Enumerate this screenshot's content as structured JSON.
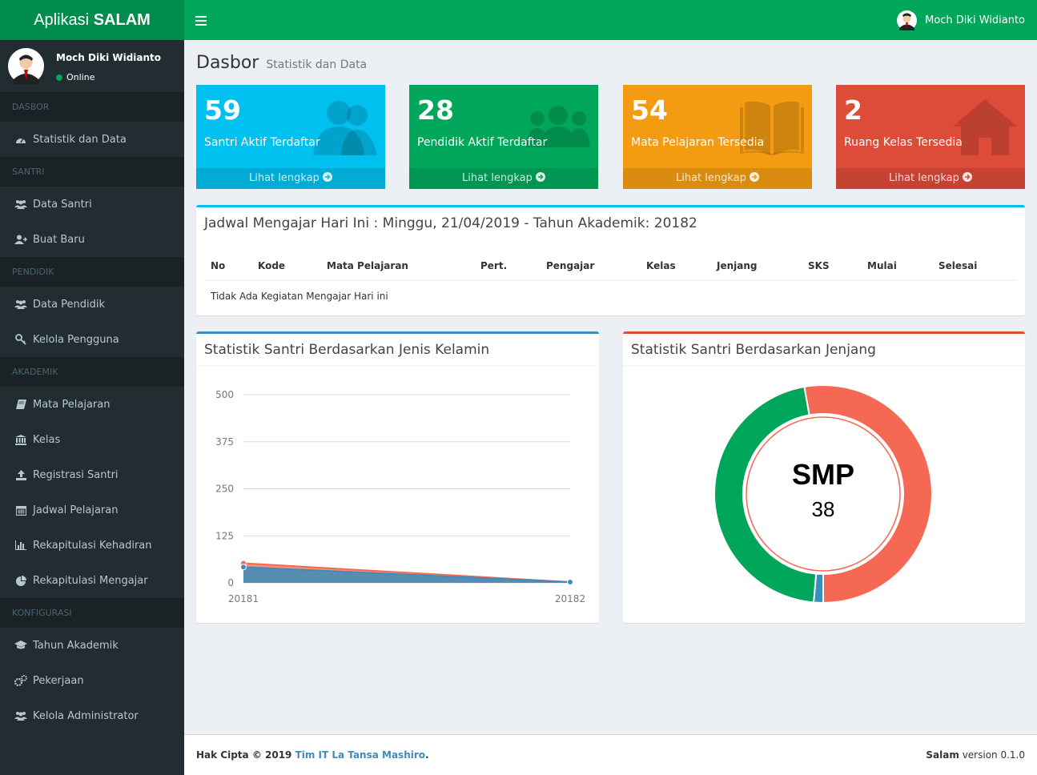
{
  "app": {
    "title_prefix": "Aplikasi ",
    "title_brand": "SALAM"
  },
  "user": {
    "name": "Moch Diki Widianto",
    "status": "Online"
  },
  "sidebar": {
    "sections": [
      {
        "header": "DASBOR",
        "items": [
          {
            "label": "Statistik dan Data",
            "icon": "dashboard-icon"
          }
        ]
      },
      {
        "header": "SANTRI",
        "items": [
          {
            "label": "Data Santri",
            "icon": "users-icon"
          },
          {
            "label": "Buat Baru",
            "icon": "user-plus-icon"
          }
        ]
      },
      {
        "header": "PENDIDIK",
        "items": [
          {
            "label": "Data Pendidik",
            "icon": "users-icon"
          },
          {
            "label": "Kelola Pengguna",
            "icon": "key-icon"
          }
        ]
      },
      {
        "header": "AKADEMIK",
        "items": [
          {
            "label": "Mata Pelajaran",
            "icon": "book-icon"
          },
          {
            "label": "Kelas",
            "icon": "institution-icon"
          },
          {
            "label": "Registrasi Santri",
            "icon": "upload-icon"
          },
          {
            "label": "Jadwal Pelajaran",
            "icon": "calendar-icon"
          },
          {
            "label": "Rekapitulasi Kehadiran",
            "icon": "bar-chart-icon"
          },
          {
            "label": "Rekapitulasi Mengajar",
            "icon": "pie-chart-icon"
          }
        ]
      },
      {
        "header": "KONFIGURASI",
        "items": [
          {
            "label": "Tahun Akademik",
            "icon": "graduation-cap-icon"
          },
          {
            "label": "Pekerjaan",
            "icon": "gears-icon"
          },
          {
            "label": "Kelola Administrator",
            "icon": "users-icon"
          }
        ]
      }
    ]
  },
  "page": {
    "title": "Dasbor",
    "subtitle": "Statistik dan Data"
  },
  "stat_boxes": [
    {
      "value": "59",
      "label": "Santri Aktif Terdaftar",
      "more": "Lihat lengkap",
      "color": "#00c0ef",
      "icon": "users-icon"
    },
    {
      "value": "28",
      "label": "Pendidik Aktif Terdaftar",
      "more": "Lihat lengkap",
      "color": "#00a65a",
      "icon": "group-icon"
    },
    {
      "value": "54",
      "label": "Mata Pelajaran Tersedia",
      "more": "Lihat lengkap",
      "color": "#f39c12",
      "icon": "book-icon"
    },
    {
      "value": "2",
      "label": "Ruang Kelas Tersedia",
      "more": "Lihat lengkap",
      "color": "#dd4b39",
      "icon": "home-icon"
    }
  ],
  "schedule": {
    "title": "Jadwal Mengajar Hari Ini : Minggu, 21/04/2019 - Tahun Akademik: 20182",
    "columns": [
      "No",
      "Kode",
      "Mata Pelajaran",
      "Pert.",
      "Pengajar",
      "Kelas",
      "Jenjang",
      "SKS",
      "Mulai",
      "Selesai"
    ],
    "empty_message": "Tidak Ada Kegiatan Mengajar Hari ini"
  },
  "gender_chart": {
    "title": "Statistik Santri Berdasarkan Jenis Kelamin"
  },
  "level_chart": {
    "title": "Statistik Santri Berdasarkan Jenjang"
  },
  "chart_data": [
    {
      "type": "area",
      "x": [
        "20181",
        "20182"
      ],
      "ylim": [
        0,
        500
      ],
      "yticks": [
        0,
        125,
        250,
        375,
        500
      ],
      "series": [
        {
          "values": [
            52,
            2
          ],
          "color": "#f56954"
        },
        {
          "values": [
            42,
            2
          ],
          "color": "#3c8dbc"
        }
      ]
    },
    {
      "type": "pie",
      "center_label": "SMP",
      "center_value": "38",
      "slices": [
        {
          "value": 38,
          "color": "#f56954"
        },
        {
          "value": 33,
          "color": "#00a65a"
        },
        {
          "value": 1,
          "color": "#3c8dbc"
        }
      ]
    }
  ],
  "footer": {
    "copyright_prefix": "Hak Cipta © 2019 ",
    "team": "Tim IT La Tansa Mashiro",
    "suffix": ".",
    "app_name": "Salam",
    "version": " version 0.1.0"
  }
}
